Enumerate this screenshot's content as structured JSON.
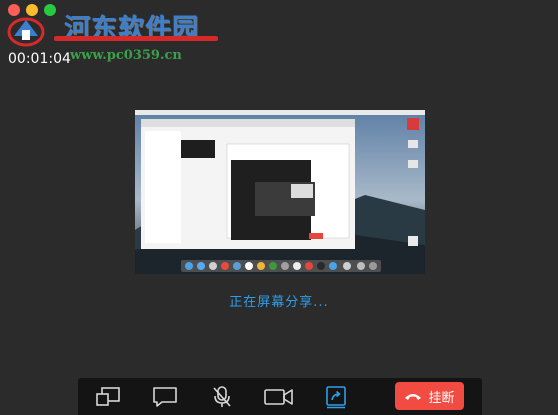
{
  "window": {
    "traffic_lights": [
      "close",
      "minimize",
      "zoom"
    ],
    "colors": {
      "close": "#fc5f57",
      "minimize": "#fdbc2e",
      "zoom": "#28c840"
    }
  },
  "watermark": {
    "title": "河东软件园",
    "url": "www.pc0359.cn"
  },
  "call": {
    "timer": "00:01:04",
    "status": "正在屏幕分享..."
  },
  "toolbar": {
    "buttons": [
      {
        "name": "switch-window",
        "icon": "dual-window-icon"
      },
      {
        "name": "chat",
        "icon": "chat-bubble-icon"
      },
      {
        "name": "mute-microphone",
        "icon": "microphone-off-icon"
      },
      {
        "name": "camera",
        "icon": "video-camera-icon"
      },
      {
        "name": "screen-share",
        "icon": "share-screen-icon",
        "active": true
      }
    ],
    "hangup_label": "挂断",
    "colors": {
      "active": "#2e9ee6",
      "hangup": "#f24b41",
      "background": "#141414"
    }
  }
}
